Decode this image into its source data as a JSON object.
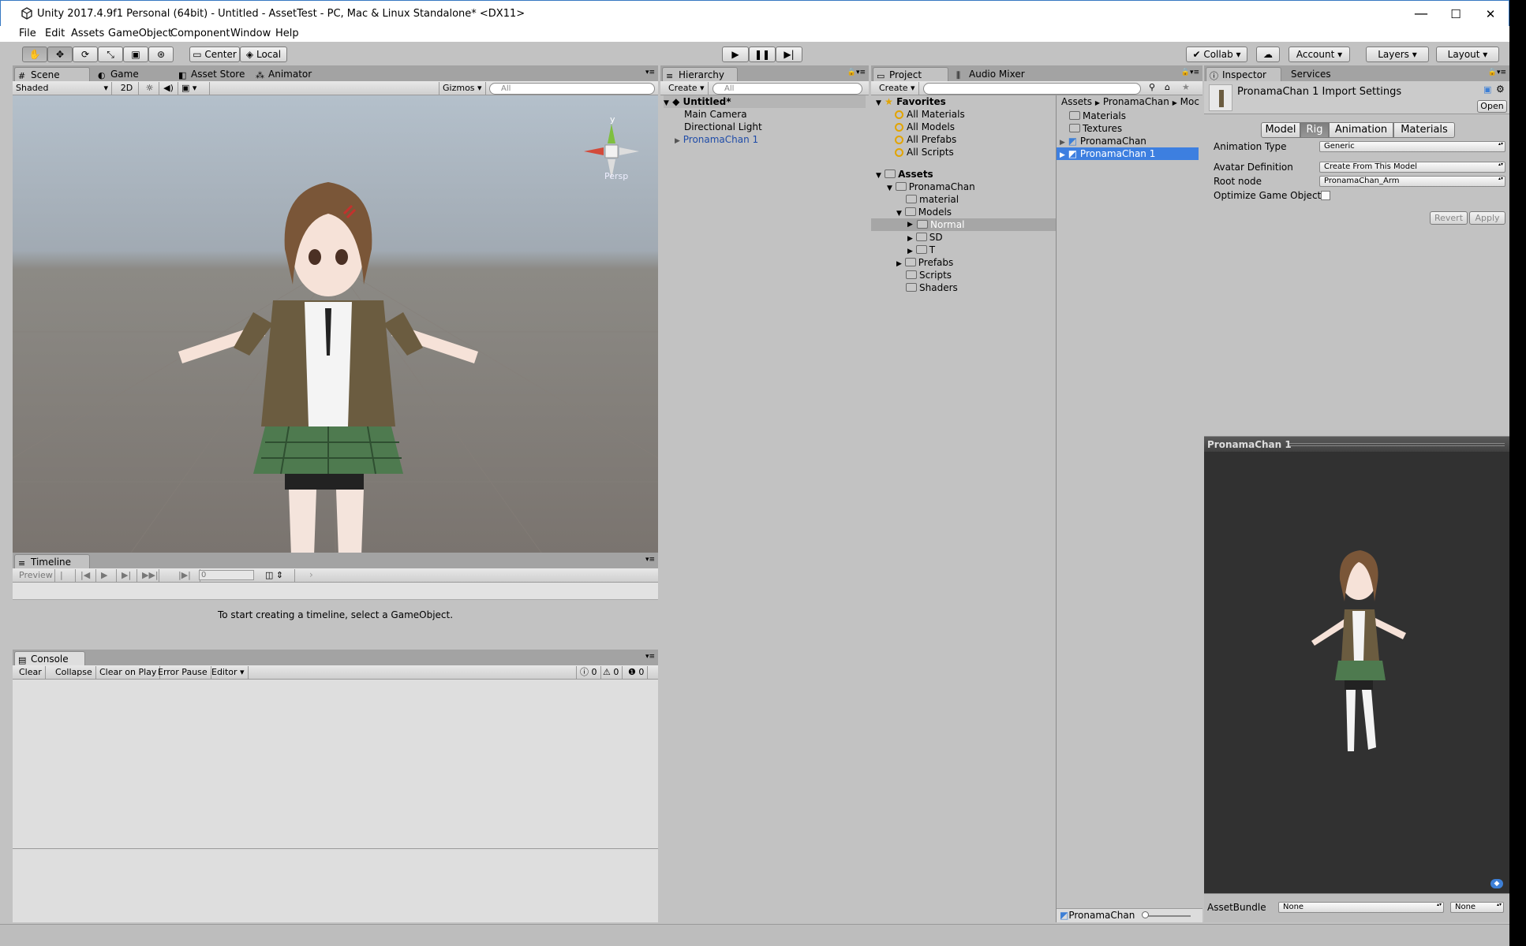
{
  "window": {
    "title": "Unity 2017.4.9f1 Personal (64bit) - Untitled - AssetTest - PC, Mac & Linux Standalone* <DX11>",
    "controls": [
      "—",
      "☐",
      "✕"
    ]
  },
  "menu": [
    "File",
    "Edit",
    "Assets",
    "GameObject",
    "Component",
    "Window",
    "Help"
  ],
  "toolbar": {
    "pivot": "Center",
    "space": "Local",
    "collab": "Collab ▾",
    "account": "Account",
    "layers": "Layers",
    "layout": "Layout"
  },
  "scene": {
    "tabs": [
      "Scene",
      "Game",
      "Asset Store",
      "Animator"
    ],
    "shading": "Shaded",
    "mode2d": "2D",
    "gizmos": "Gizmos",
    "search_placeholder": "All",
    "gizmo_axis_y": "y",
    "gizmo_persp": "Persp"
  },
  "timeline": {
    "tab": "Timeline",
    "preview": "Preview",
    "frame": "0",
    "message": "To start creating a timeline, select a GameObject."
  },
  "console": {
    "tab": "Console",
    "buttons": [
      "Clear",
      "Collapse",
      "Clear on Play",
      "Error Pause",
      "Editor"
    ],
    "info_count": "0",
    "warn_count": "0",
    "error_count": "0"
  },
  "hierarchy": {
    "tab": "Hierarchy",
    "create": "Create",
    "search_placeholder": "All",
    "scene_name": "Untitled*",
    "items": [
      "Main Camera",
      "Directional Light",
      "PronamaChan 1"
    ]
  },
  "project": {
    "tabs": [
      "Project",
      "Audio Mixer"
    ],
    "create": "Create",
    "favorites_label": "Favorites",
    "favorites": [
      "All Materials",
      "All Models",
      "All Prefabs",
      "All Scripts"
    ],
    "assets_label": "Assets",
    "tree": [
      "PronamaChan",
      "material",
      "Models",
      "Normal",
      "SD",
      "T",
      "Prefabs",
      "Scripts",
      "Shaders"
    ],
    "breadcrumb": [
      "Assets",
      "PronamaChan",
      "Moc"
    ],
    "files": [
      "Materials",
      "Textures",
      "PronamaChan",
      "PronamaChan 1"
    ],
    "footer_selected": "PronamaChan"
  },
  "inspector": {
    "tabs": [
      "Inspector",
      "Services"
    ],
    "title": "PronamaChan 1 Import Settings",
    "open": "Open",
    "seg_tabs": [
      "Model",
      "Rig",
      "Animation",
      "Materials"
    ],
    "fields": [
      {
        "label": "Animation Type",
        "value": "Generic"
      },
      {
        "label": "Avatar Definition",
        "value": "Create From This Model"
      },
      {
        "label": "Root node",
        "value": "PronamaChan_Arm"
      },
      {
        "label": "Optimize Game Objects",
        "value": ""
      }
    ],
    "revert": "Revert",
    "apply": "Apply",
    "preview_title": "PronamaChan 1",
    "assetbundle_label": "AssetBundle",
    "assetbundle_value": "None",
    "assetbundle_variant": "None"
  }
}
